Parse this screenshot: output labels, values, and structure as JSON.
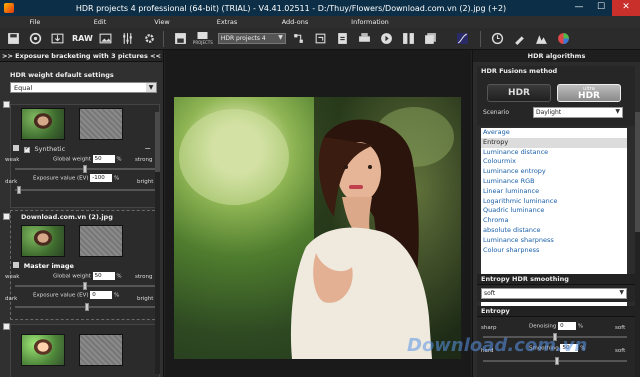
{
  "window": {
    "title": "HDR projects 4 professional (64-bit) (TRIAL) - V4.41.02511 - D:/Thuy/Flowers/Download.com.vn (2).jpg (+2)",
    "minimize": "—",
    "maximize": "☐",
    "close": "✕"
  },
  "menu": [
    {
      "label": "File"
    },
    {
      "label": "Edit"
    },
    {
      "label": "View"
    },
    {
      "label": "Extras"
    },
    {
      "label": "Add-ons"
    },
    {
      "label": "Information"
    }
  ],
  "toolbar": {
    "raw_label": "RAW",
    "projects_label": "PROJECTS",
    "project_combo": "HDR projects 4"
  },
  "left": {
    "header": ">> Exposure bracketing with 3 pictures <<",
    "weight_title": "HDR weight default settings",
    "weight_value": "Equal",
    "img1": {
      "checkbox_label": "Synthetic",
      "weak": "weak",
      "strong": "strong",
      "global_weight_label": "Global weight",
      "global_weight": "50",
      "pct": "%",
      "dark": "dark",
      "bright": "bright",
      "ev_label": "Exposure value (EV)",
      "ev": "-100",
      "ev_pct": "%",
      "collapse": "−"
    },
    "img2": {
      "filename": "Download.com.vn (2).jpg",
      "master_label": "Master image",
      "weak": "weak",
      "strong": "strong",
      "global_weight_label": "Global weight",
      "global_weight": "50",
      "pct": "%",
      "dark": "dark",
      "bright": "bright",
      "ev_label": "Exposure value (EV)",
      "ev": "0",
      "ev_pct": "%"
    }
  },
  "right": {
    "title": "HDR algorithms",
    "fusion_title": "HDR Fusions method",
    "hdr_button": "HDR",
    "ultra_small": "ultra",
    "ultra_big": "HDR",
    "scenario_label": "Scenario",
    "scenario_value": "Daylight",
    "algorithms": [
      "Average",
      "Entropy",
      "Luminance distance",
      "Colourmix",
      "Luminance entropy",
      "Luminance RGB",
      "Linear luminance",
      "Logarithmic luminance",
      "Quadric luminance",
      "Chroma",
      "absolute distance",
      "Luminance sharpness",
      "Colour sharpness"
    ],
    "selected_index": 1,
    "smoothing_title": "Entropy HDR smoothing",
    "smoothing_value": "soft",
    "entropy_title": "Entropy",
    "sharp": "sharp",
    "denoising_label": "Denoising",
    "denoising_value": "0",
    "pct": "%",
    "soft": "soft",
    "hard": "hard",
    "smoothing_label": "Smoothing",
    "smoothing_num": "50",
    "soft2": "soft"
  },
  "watermark": "Download.com.vn",
  "colors": {
    "titlebar": "#0c2f47",
    "panel": "#303030",
    "accent": "#1a5fa8",
    "close": "#c9302c"
  }
}
